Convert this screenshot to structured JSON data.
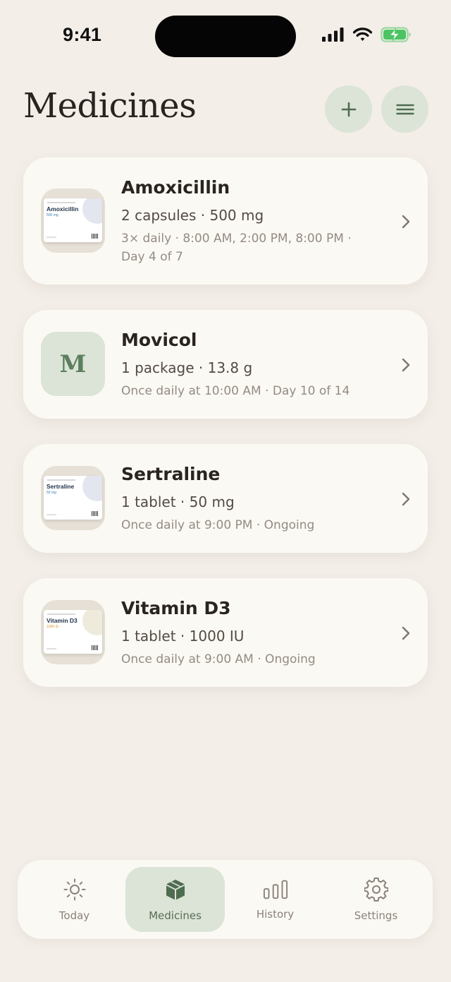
{
  "status_bar": {
    "time": "9:41"
  },
  "header": {
    "title": "Medicines"
  },
  "medicines": [
    {
      "name": "Amoxicillin",
      "dose": "2 capsules · 500 mg",
      "schedule": "3× daily · 8:00 AM, 2:00 PM, 8:00 PM · Day 4 of 7",
      "thumbnail": {
        "type": "package",
        "label": "Amoxicillin",
        "strength": "500 mg",
        "accent": "#3a7fb5"
      }
    },
    {
      "name": "Movicol",
      "dose": "1 package · 13.8 g",
      "schedule": "Once daily at 10:00 AM · Day 10 of 14",
      "thumbnail": {
        "type": "letter",
        "letter": "M"
      }
    },
    {
      "name": "Sertraline",
      "dose": "1 tablet · 50 mg",
      "schedule": "Once daily at 9:00 PM · Ongoing",
      "thumbnail": {
        "type": "package",
        "label": "Sertraline",
        "strength": "50 mg",
        "accent": "#3a7fb5"
      }
    },
    {
      "name": "Vitamin D3",
      "dose": "1 tablet · 1000 IU",
      "schedule": "Once daily at 9:00 AM · Ongoing",
      "thumbnail": {
        "type": "package",
        "label": "Vitamin D3",
        "strength": "1000 IU",
        "accent": "#d9962e"
      }
    }
  ],
  "tab_bar": {
    "tabs": [
      {
        "label": "Today",
        "icon": "sun-icon",
        "active": false
      },
      {
        "label": "Medicines",
        "icon": "box-icon",
        "active": true
      },
      {
        "label": "History",
        "icon": "bar-chart-icon",
        "active": false
      },
      {
        "label": "Settings",
        "icon": "gear-icon",
        "active": false
      }
    ]
  },
  "colors": {
    "background": "#f3eee8",
    "card": "#fbf9f4",
    "accent_soft": "#dbe4d6",
    "accent": "#5d7f5e",
    "text_primary": "#2a2420",
    "text_secondary": "#948b83"
  }
}
